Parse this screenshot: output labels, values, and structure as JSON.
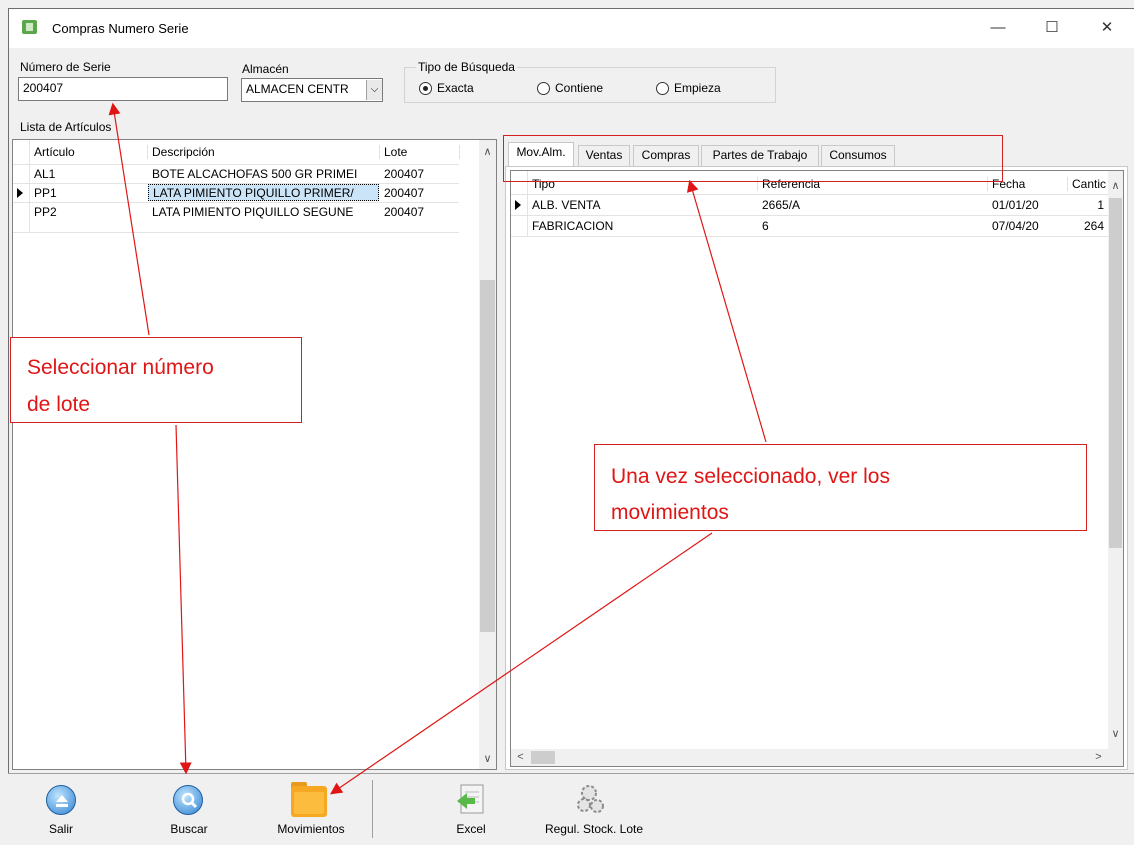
{
  "window": {
    "title": "Compras Numero Serie",
    "minimize": "—",
    "maximize": "☐",
    "close": "✕"
  },
  "search": {
    "serial_label": "Número de Serie",
    "serial_value": "200407",
    "warehouse_label": "Almacén",
    "warehouse_value": "ALMACEN CENTR",
    "search_type_label": "Tipo de Búsqueda",
    "options": [
      "Exacta",
      "Contiene",
      "Empieza"
    ],
    "selected": "Exacta"
  },
  "articles": {
    "label": "Lista de Artículos",
    "headers": [
      "Artículo",
      "Descripción",
      "Lote"
    ],
    "rows": [
      [
        "AL1",
        "BOTE ALCACHOFAS 500 GR PRIMEI",
        "200407"
      ],
      [
        "PP1",
        "LATA PIMIENTO PIQUILLO PRIMER/",
        "200407"
      ],
      [
        "PP2",
        "LATA PIMIENTO PIQUILLO SEGUNE",
        "200407"
      ]
    ]
  },
  "tabs": [
    "Mov.Alm.",
    "Ventas",
    "Compras",
    "Partes de Trabajo",
    "Consumos"
  ],
  "movements": {
    "headers": [
      "Tipo",
      "Referencia",
      "Fecha",
      "Cantic"
    ],
    "rows": [
      [
        "ALB. VENTA",
        "2665/A",
        "01/01/20",
        "1"
      ],
      [
        "FABRICACION",
        "6",
        "07/04/20",
        "264"
      ]
    ]
  },
  "toolbar": {
    "salir": "Salir",
    "buscar": "Buscar",
    "movimientos": "Movimientos",
    "excel": "Excel",
    "regul": "Regul. Stock. Lote"
  },
  "annotations": {
    "left_line1": "Seleccionar número",
    "left_line2": "de lote",
    "right_line1": "Una vez seleccionado, ver los",
    "right_line2": "movimientos"
  },
  "colors": {
    "annotation": "#e01616",
    "selection": "#cce4f7"
  }
}
